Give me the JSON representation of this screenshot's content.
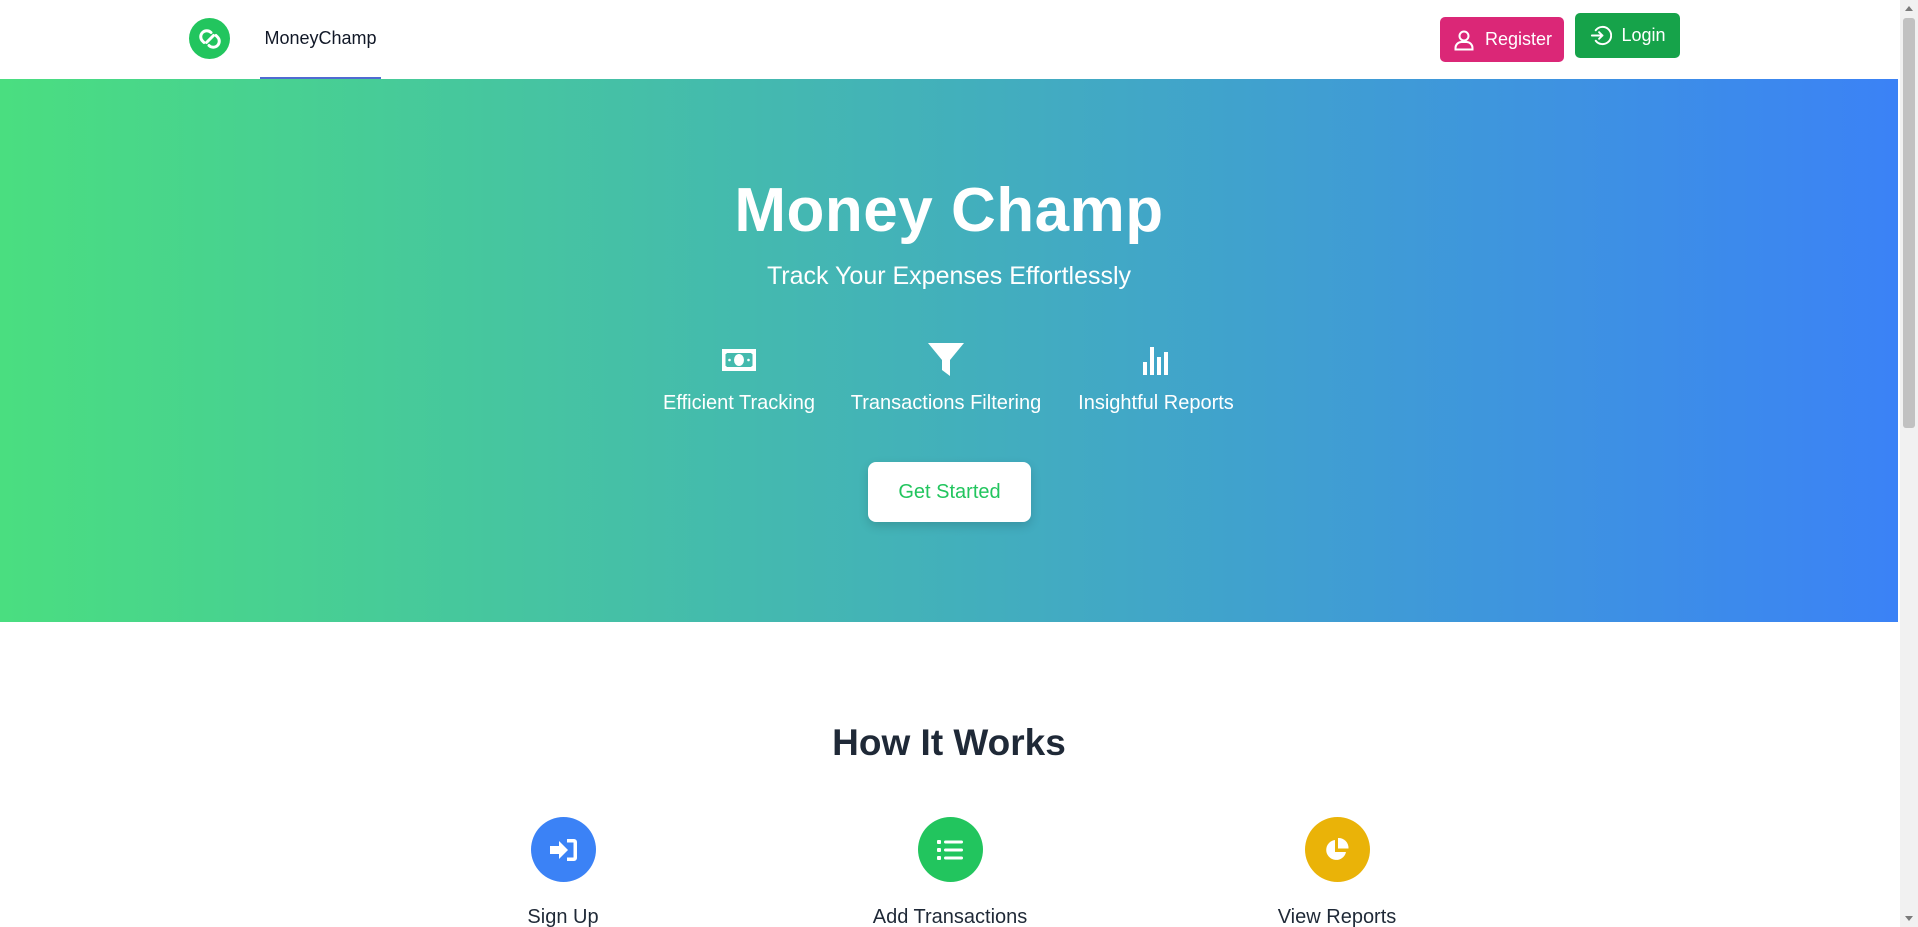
{
  "navbar": {
    "brand_name": "MoneyChamp",
    "logo_icon": "link-chain-icon",
    "register_label": "Register",
    "register_icon": "user-icon",
    "login_label": "Login",
    "login_icon": "sign-in-icon"
  },
  "hero": {
    "title": "Money Champ",
    "subtitle": "Track Your Expenses Effortlessly",
    "features": [
      {
        "label": "Efficient Tracking",
        "icon": "money-bill-icon"
      },
      {
        "label": "Transactions Filtering",
        "icon": "filter-icon"
      },
      {
        "label": "Insightful Reports",
        "icon": "bar-chart-icon"
      }
    ],
    "cta_label": "Get Started"
  },
  "how_it_works": {
    "title": "How It Works",
    "steps": [
      {
        "label": "Sign Up",
        "icon": "sign-in-icon",
        "color": "#3b82f6"
      },
      {
        "label": "Add Transactions",
        "icon": "list-icon",
        "color": "#22c55e"
      },
      {
        "label": "View Reports",
        "icon": "pie-chart-icon",
        "color": "#eab308"
      }
    ]
  },
  "colors": {
    "brand": "#22c55e",
    "register": "#db2777",
    "login": "#16a34a",
    "hero_gradient_start": "#4ade80",
    "hero_gradient_end": "#3b82f6"
  }
}
